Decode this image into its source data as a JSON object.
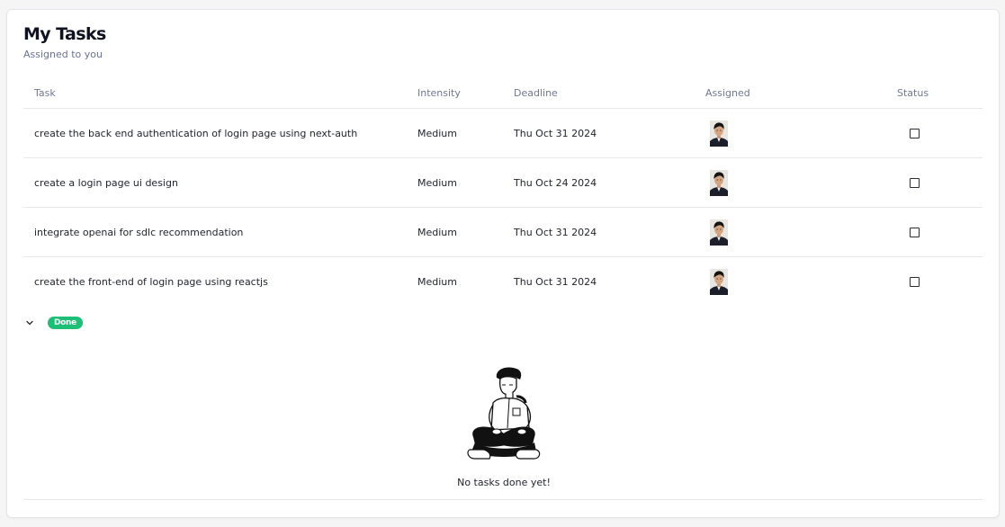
{
  "header": {
    "title": "My Tasks",
    "subtitle": "Assigned to you"
  },
  "table": {
    "columns": [
      "Task",
      "Intensity",
      "Deadline",
      "Assigned",
      "Status"
    ],
    "rows": [
      {
        "task": "create the back end authentication of login page using next-auth",
        "intensity": "Medium",
        "deadline": "Thu Oct 31 2024",
        "assigned_icon": "user-avatar",
        "status_checked": false
      },
      {
        "task": "create a login page ui design",
        "intensity": "Medium",
        "deadline": "Thu Oct 24 2024",
        "assigned_icon": "user-avatar",
        "status_checked": false
      },
      {
        "task": "integrate openai for sdlc recommendation",
        "intensity": "Medium",
        "deadline": "Thu Oct 31 2024",
        "assigned_icon": "user-avatar",
        "status_checked": false
      },
      {
        "task": "create the front-end of login page using reactjs",
        "intensity": "Medium",
        "deadline": "Thu Oct 31 2024",
        "assigned_icon": "user-avatar",
        "status_checked": false
      }
    ]
  },
  "done_section": {
    "badge_label": "Done",
    "badge_color": "#1dbf77",
    "toggle_icon": "chevron-down-icon",
    "empty_message": "No tasks done yet!",
    "illustration": "person-sitting-cross-legged"
  }
}
